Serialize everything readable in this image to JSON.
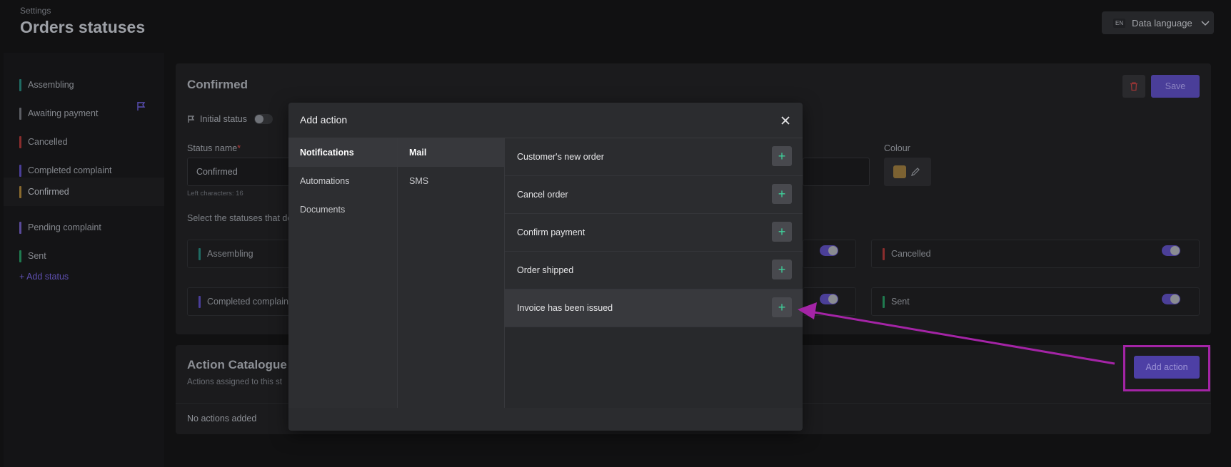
{
  "header": {
    "breadcrumb": "Settings",
    "title": "Orders statuses",
    "language_badge": "EN",
    "language_label": "Data language"
  },
  "sidebar": {
    "items": [
      {
        "label": "Assembling",
        "color": "#1f6b63"
      },
      {
        "label": "Awaiting payment",
        "color": "#5b5d63"
      },
      {
        "label": "Cancelled",
        "color": "#8a2d2d"
      },
      {
        "label": "Completed complaint",
        "color": "#4a3e99"
      },
      {
        "label": "Confirmed",
        "color": "#8a6a2e"
      },
      {
        "label": "Pending complaint",
        "color": "#5a4a9a"
      },
      {
        "label": "Sent",
        "color": "#1f7a4f"
      }
    ],
    "add_status": "+ Add status"
  },
  "status_card": {
    "title": "Confirmed",
    "save_label": "Save",
    "initial_status_label": "Initial status",
    "status_name_label": "Status name",
    "required_mark": "*",
    "status_name_value": "Confirmed",
    "left_characters": "Left characters: 16",
    "select_statuses_text": "Select the statuses that de",
    "colour_label": "Colour",
    "colour_value": "#7c6232",
    "status_boxes": [
      {
        "label": "Assembling",
        "color": "#1f6b63",
        "enabled": false
      },
      {
        "label": "Cancelled",
        "color": "#8a2d2d",
        "enabled": true
      },
      {
        "label": "Completed complaint",
        "color": "#4a3e99",
        "enabled": false
      },
      {
        "label": "Sent",
        "color": "#1f7a4f",
        "enabled": true
      }
    ]
  },
  "action_catalogue": {
    "title": "Action Catalogue",
    "subtitle": "Actions assigned to this st",
    "empty_text": "No actions added",
    "add_action_label": "Add action"
  },
  "modal": {
    "title": "Add action",
    "categories": [
      "Notifications",
      "Automations",
      "Documents"
    ],
    "channels": [
      "Mail",
      "SMS"
    ],
    "actions": [
      "Customer's new order",
      "Cancel order",
      "Confirm payment",
      "Order shipped",
      "Invoice has been issued"
    ],
    "selected_category": "Notifications",
    "selected_channel": "Mail",
    "highlighted_action": "Invoice has been issued"
  },
  "colors": {
    "accent": "#4d3fa5",
    "plus": "#3fcf9a",
    "annotation": "#a424a6"
  }
}
